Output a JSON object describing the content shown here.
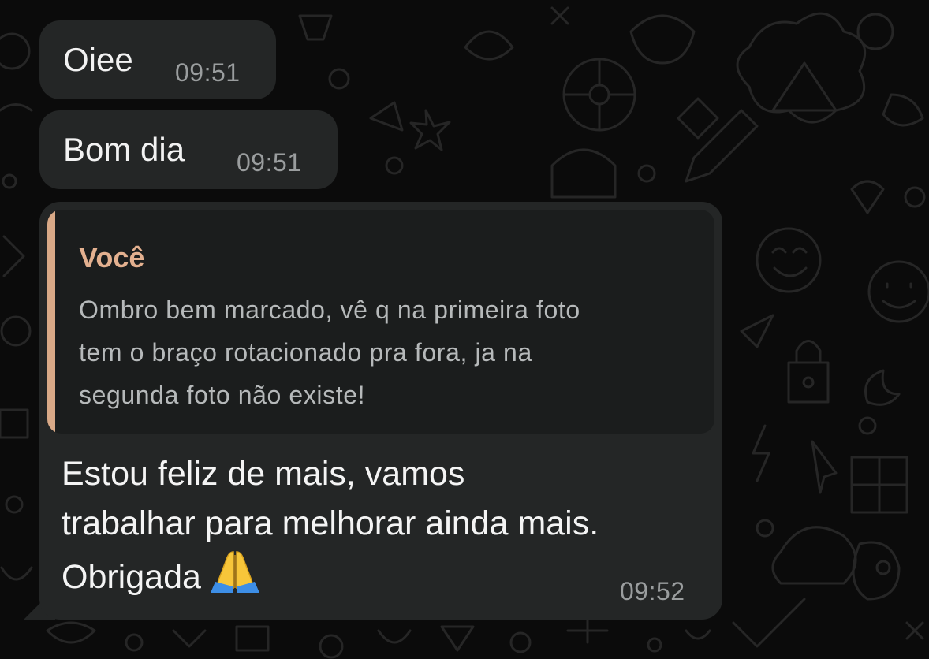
{
  "conversation": {
    "messages": [
      {
        "text": "Oiee",
        "time": "09:51"
      },
      {
        "text": "Bom dia",
        "time": "09:51"
      },
      {
        "quote": {
          "author": "Você",
          "lines": [
            "Ombro bem marcado, vê q na primeira foto",
            "tem o braço rotacionado pra fora, ja na",
            "segunda foto não existe!"
          ]
        },
        "lines": [
          "Estou feliz de mais, vamos",
          "trabalhar para melhorar ainda mais.",
          "Obrigada"
        ],
        "emoji": "🙏",
        "emoji_icon": "folded-hands-icon",
        "time": "09:52"
      }
    ]
  },
  "colors": {
    "background": "#0b0b0b",
    "bubble": "#242626",
    "quote_background": "#1b1d1d",
    "quote_accent": "#d9a987",
    "quote_author": "#e3b08f",
    "timestamp": "#9a9d9e"
  }
}
